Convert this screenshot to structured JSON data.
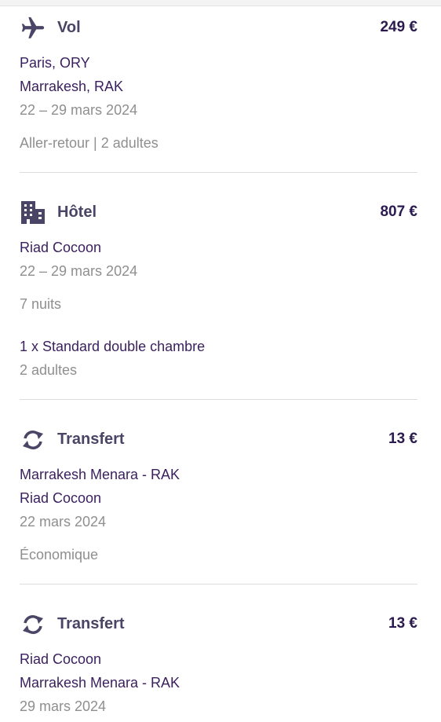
{
  "sections": {
    "flight": {
      "icon": "plane-icon",
      "title": "Vol",
      "price": "249 €",
      "from": "Paris, ORY",
      "to": "Marrakesh, RAK",
      "dates": "22 – 29 mars 2024",
      "trip_info": "Aller-retour | 2 adultes"
    },
    "hotel": {
      "icon": "hotel-building-icon",
      "title": "Hôtel",
      "price": "807 €",
      "name": "Riad Cocoon",
      "dates": "22 – 29 mars 2024",
      "nights": "7 nuits",
      "room": "1 x Standard double chambre",
      "guests": "2 adultes"
    },
    "transfer_outbound": {
      "icon": "transfer-icon",
      "title": "Transfert",
      "price": "13 €",
      "from": "Marrakesh Menara - RAK",
      "to": "Riad Cocoon",
      "date": "22 mars 2024",
      "category": "Économique"
    },
    "transfer_return": {
      "icon": "transfer-icon",
      "title": "Transfert",
      "price": "13 €",
      "from": "Riad Cocoon",
      "to": "Marrakesh Menara - RAK",
      "date": "29 mars 2024"
    }
  },
  "colors": {
    "title": "#4a4566",
    "price": "#2a1a4e",
    "primary_text": "#3a1f5e",
    "secondary_text": "#8f8f8f",
    "icon": "#4a4566",
    "divider": "#dddddd"
  }
}
